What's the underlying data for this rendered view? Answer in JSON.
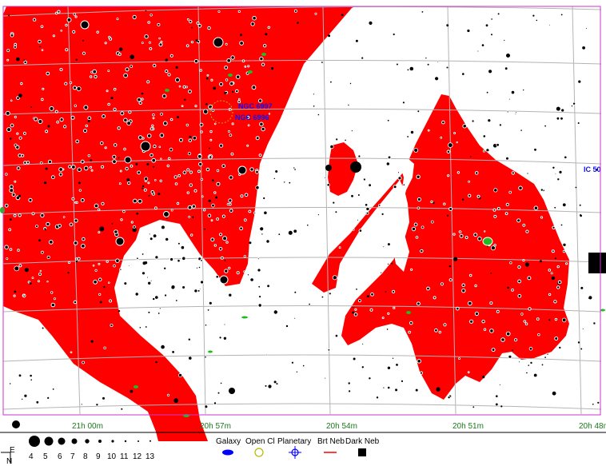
{
  "map": {
    "ra_labels": [
      "21h 00m",
      "20h 57m",
      "20h 54m",
      "20h 51m",
      "20h 48m"
    ],
    "object_labels": {
      "ngc_6997": "NGC 6997",
      "ngc_6996": "NGC 6996",
      "ic_50": "IC 50"
    }
  },
  "legend": {
    "compass": {
      "east": "E",
      "north": "N"
    },
    "magnitudes": [
      "4",
      "5",
      "6",
      "7",
      "8",
      "9",
      "10",
      "11",
      "12",
      "13"
    ],
    "object_types": [
      "Galaxy",
      "Open Cl",
      "Planetary",
      "Brt Neb",
      "Dark Neb"
    ]
  },
  "colors": {
    "nebula": "#ff0000",
    "grid": "#b4b4b4",
    "border": "#cc33cc",
    "ra_label": "#1a7a1a",
    "object_label": "#1010ee",
    "galaxy": "#0000ff",
    "open_cluster": "#b8b800",
    "planetary_nebula": "#0000ff",
    "bright_nebula": "#ff0000",
    "dark_nebula": "#000000"
  }
}
